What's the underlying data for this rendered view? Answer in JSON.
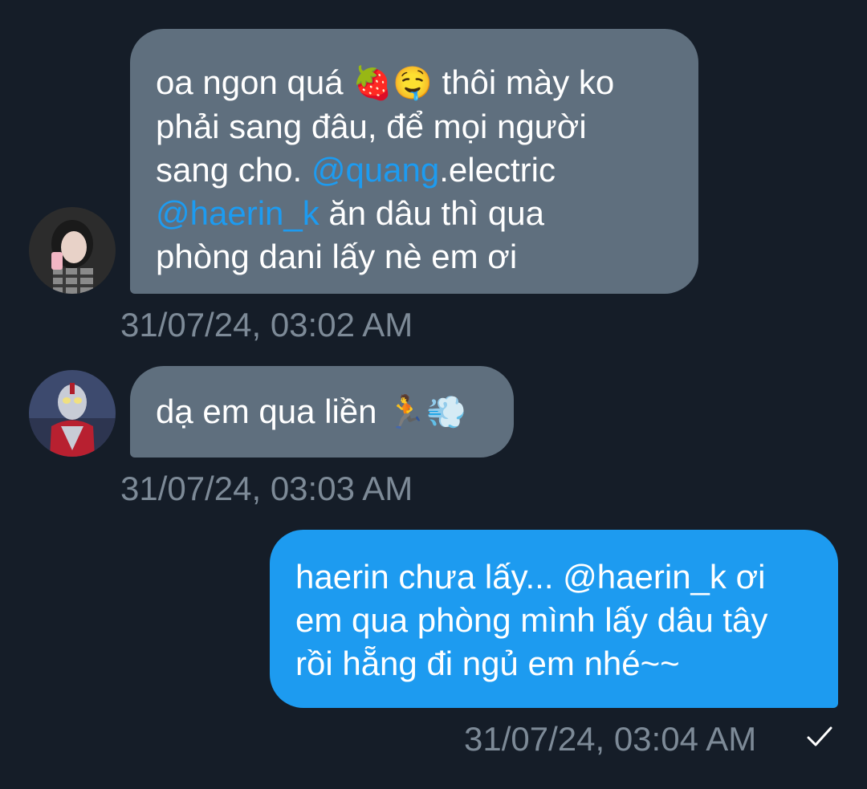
{
  "messages": [
    {
      "direction": "in",
      "lines": [
        [
          {
            "t": "oa ngon quá "
          },
          {
            "t": "🍓",
            "emoji": true
          },
          {
            "t": "🤤",
            "emoji": true
          },
          {
            "t": " thôi mày ko"
          }
        ],
        [
          {
            "t": "phải sang đâu, để mọi người"
          }
        ],
        [
          {
            "t": "sang cho. "
          },
          {
            "t": "@quang",
            "mention": true
          },
          {
            "t": ".electric"
          }
        ],
        [
          {
            "t": "@haerin_k",
            "mention": true
          },
          {
            "t": " ăn dâu thì qua"
          }
        ],
        [
          {
            "t": "phòng dani lấy nè em ơi"
          }
        ]
      ],
      "timestamp": "31/07/24, 03:02 AM"
    },
    {
      "direction": "in",
      "lines": [
        [
          {
            "t": "dạ em qua liền "
          },
          {
            "t": "🏃",
            "emoji": true
          },
          {
            "t": "💨",
            "emoji": true
          }
        ]
      ],
      "timestamp": "31/07/24, 03:03 AM"
    },
    {
      "direction": "out",
      "lines": [
        [
          {
            "t": "haerin chưa lấy... @haerin_k ơi"
          }
        ],
        [
          {
            "t": "em qua phòng mình lấy dâu tây"
          }
        ],
        [
          {
            "t": "rồi hẵng đi ngủ em nhé~~"
          }
        ]
      ],
      "timestamp": "31/07/24, 03:04 AM",
      "status_icon": "check-icon"
    }
  ],
  "colors": {
    "background": "#151d28",
    "incoming_bubble": "#5f6f7e",
    "outgoing_bubble": "#1d9bf0",
    "mention": "#1d9bf0",
    "timestamp": "#7d8a97"
  }
}
